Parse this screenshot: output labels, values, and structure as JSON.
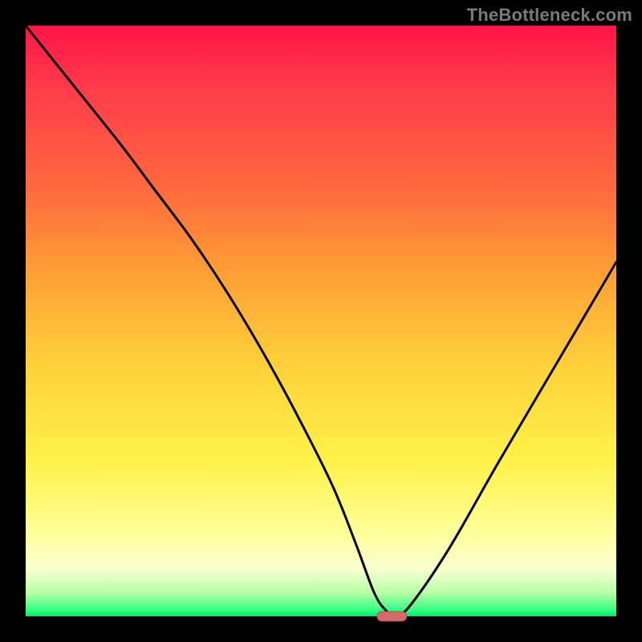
{
  "watermark": "TheBottleneck.com",
  "colors": {
    "frame": "#000000",
    "curve": "#000000",
    "marker_fill": "#d46a6a",
    "marker_stroke": "#b84e4e"
  },
  "chart_data": {
    "type": "line",
    "title": "",
    "xlabel": "",
    "ylabel": "",
    "xlim": [
      0,
      100
    ],
    "ylim": [
      0,
      100
    ],
    "grid": false,
    "legend": false,
    "series": [
      {
        "name": "bottleneck-curve",
        "x": [
          0,
          8,
          16,
          22,
          28,
          34,
          40,
          46,
          52,
          56,
          59,
          61,
          63,
          66,
          72,
          80,
          90,
          100
        ],
        "values": [
          100,
          90,
          80,
          72,
          64,
          55,
          45,
          34,
          22,
          12,
          4,
          1,
          0,
          3,
          12,
          26,
          43,
          60
        ]
      }
    ],
    "marker": {
      "x": 62,
      "y": 0,
      "width_frac": 0.05
    }
  }
}
